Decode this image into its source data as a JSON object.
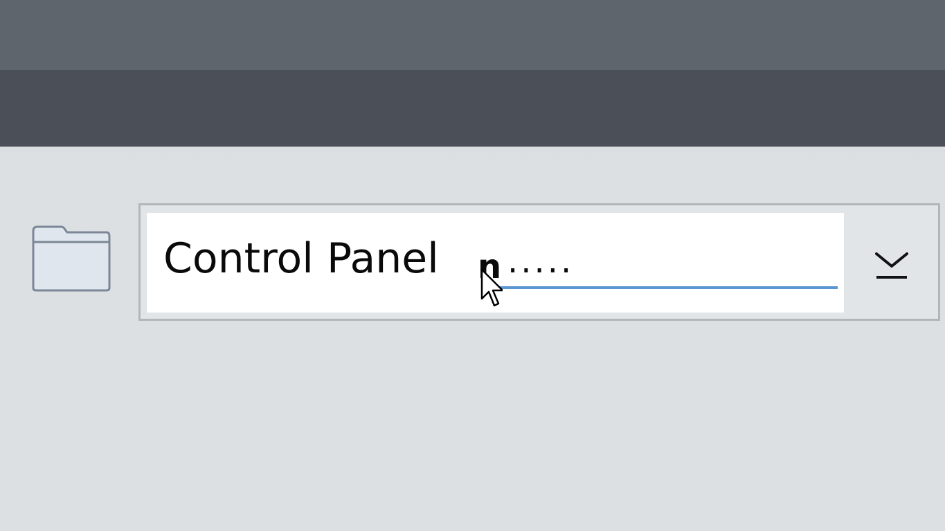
{
  "titlebar": {
    "top_color": "#5f656d",
    "bottom_color": "#4b5058"
  },
  "address_bar": {
    "value": "Control Panel",
    "typed_char": "n",
    "trailing_dots": ".....",
    "icon": "folder-icon",
    "dropdown_icon": "chevron-down-bar-icon",
    "underline_color": "#5b96d1"
  },
  "pointer": {
    "icon": "mouse-cursor-icon"
  }
}
